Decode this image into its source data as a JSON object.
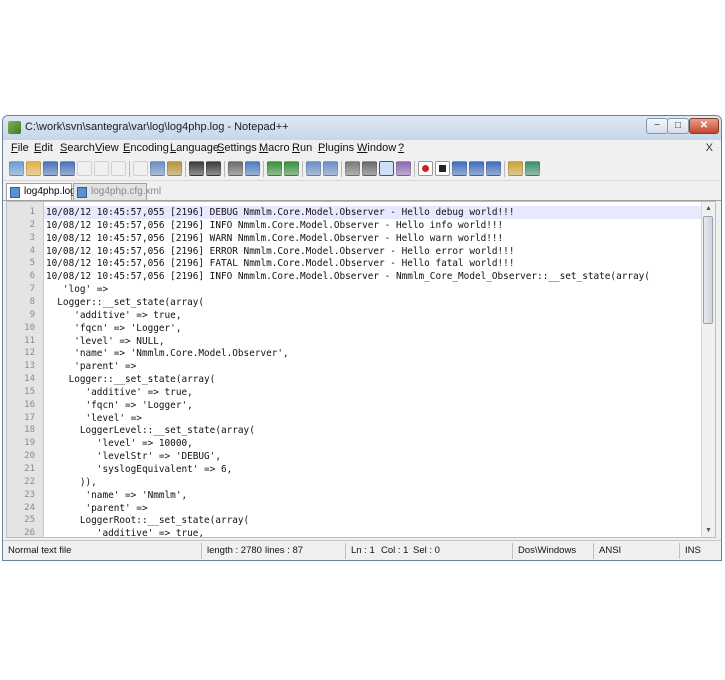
{
  "window": {
    "title": "C:\\work\\svn\\santegra\\var\\log\\log4php.log - Notepad++",
    "min_glyph": "−",
    "max_glyph": "□",
    "close_glyph": "✕",
    "doc_close": "X"
  },
  "menu": [
    "File",
    "Edit",
    "Search",
    "View",
    "Encoding",
    "Language",
    "Settings",
    "Macro",
    "Run",
    "Plugins",
    "Window",
    "?"
  ],
  "toolbar": {
    "icons": [
      "new-file-icon",
      "open-file-icon",
      "save-icon",
      "save-all-icon",
      "close-file-icon",
      "close-all-icon",
      "print-icon",
      "cut-icon",
      "copy-icon",
      "paste-icon",
      "undo-icon",
      "redo-icon",
      "find-icon",
      "replace-icon",
      "zoom-in-icon",
      "zoom-out-icon",
      "sync-vertical-icon",
      "sync-horizontal-icon",
      "word-wrap-icon",
      "show-all-chars-icon",
      "indent-guide-icon",
      "user-lang-icon",
      "record-macro-icon",
      "stop-macro-icon",
      "play-macro-icon",
      "play-multiple-icon",
      "save-macro-icon",
      "monitor-icon",
      "spell-check-icon"
    ],
    "active_icon": "indent-guide-icon",
    "accent": "#1f5fa8",
    "record_color": "#d21f1f"
  },
  "tabs": [
    {
      "label": "log4php.log",
      "active": true
    },
    {
      "label": "log4php.cfg.xml",
      "active": false
    }
  ],
  "editor": {
    "current_line": 1,
    "lines": [
      {
        "n": "1",
        "text": "10/08/12 10:45:57,055 [2196] DEBUG Nmmlm.Core.Model.Observer - Hello debug world!!!"
      },
      {
        "n": "2",
        "text": "10/08/12 10:45:57,056 [2196] INFO Nmmlm.Core.Model.Observer - Hello info world!!!"
      },
      {
        "n": "3",
        "text": "10/08/12 10:45:57,056 [2196] WARN Nmmlm.Core.Model.Observer - Hello warn world!!!"
      },
      {
        "n": "4",
        "text": "10/08/12 10:45:57,056 [2196] ERROR Nmmlm.Core.Model.Observer - Hello error world!!!"
      },
      {
        "n": "5",
        "text": "10/08/12 10:45:57,056 [2196] FATAL Nmmlm.Core.Model.Observer - Hello fatal world!!!"
      },
      {
        "n": "6",
        "text": "10/08/12 10:45:57,056 [2196] INFO Nmmlm.Core.Model.Observer - Nmmlm_Core_Model_Observer::__set_state(array("
      },
      {
        "n": "7",
        "text": "   'log' =>"
      },
      {
        "n": "8",
        "text": "  Logger::__set_state(array("
      },
      {
        "n": "9",
        "text": "     'additive' => true,"
      },
      {
        "n": "10",
        "text": "     'fqcn' => 'Logger',"
      },
      {
        "n": "11",
        "text": "     'level' => NULL,"
      },
      {
        "n": "12",
        "text": "     'name' => 'Nmmlm.Core.Model.Observer',"
      },
      {
        "n": "13",
        "text": "     'parent' =>"
      },
      {
        "n": "14",
        "text": "    Logger::__set_state(array("
      },
      {
        "n": "15",
        "text": "       'additive' => true,"
      },
      {
        "n": "16",
        "text": "       'fqcn' => 'Logger',"
      },
      {
        "n": "17",
        "text": "       'level' =>"
      },
      {
        "n": "18",
        "text": "      LoggerLevel::__set_state(array("
      },
      {
        "n": "19",
        "text": "         'level' => 10000,"
      },
      {
        "n": "20",
        "text": "         'levelStr' => 'DEBUG',"
      },
      {
        "n": "21",
        "text": "         'syslogEquivalent' => 6,"
      },
      {
        "n": "22",
        "text": "      )),"
      },
      {
        "n": "23",
        "text": "       'name' => 'Nmmlm',"
      },
      {
        "n": "24",
        "text": "       'parent' =>"
      },
      {
        "n": "25",
        "text": "      LoggerRoot::__set_state(array("
      },
      {
        "n": "26",
        "text": "         'additive' => true,"
      }
    ]
  },
  "scrollbar": {
    "up": "▲",
    "down": "▼"
  },
  "status": {
    "type": "Normal text file",
    "length": "length : 2780",
    "lines": "lines : 87",
    "ln": "Ln : 1",
    "col": "Col : 1",
    "sel": "Sel : 0",
    "eol": "Dos\\Windows",
    "encoding": "ANSI",
    "mode": "INS"
  }
}
